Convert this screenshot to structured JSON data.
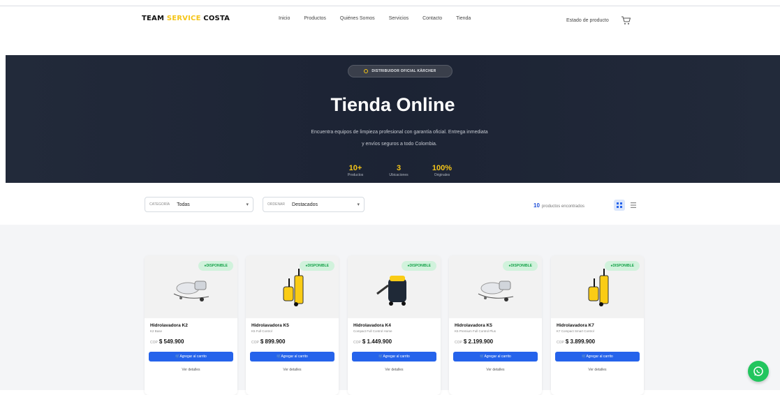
{
  "brand": {
    "part1": "TEAM",
    "part2": "SERVICE",
    "part3": "COSTA"
  },
  "nav": [
    "Inicio",
    "Productos",
    "Quiénes Somos",
    "Servicios",
    "Contacto",
    "Tienda"
  ],
  "header": {
    "status_link": "Estado de producto",
    "cart_icon": "cart-icon"
  },
  "hero": {
    "badge": "DISTRIBUIDOR OFICIAL KÄRCHER",
    "title": "Tienda Online",
    "subtitle_line1": "Encuentra equipos de limpieza profesional con garantía oficial. Entrega inmediata",
    "subtitle_line2": "y envíos seguros a todo Colombia.",
    "stats": [
      {
        "value": "10+",
        "label": "Productos"
      },
      {
        "value": "3",
        "label": "Ubicaciones"
      },
      {
        "value": "100%",
        "label": "Originales"
      }
    ]
  },
  "filters": {
    "category_label": "Categoría",
    "category_value": "Todas",
    "order_label": "Ordenar",
    "order_value": "Destacados",
    "found_count": "10",
    "found_text": "productos encontrados"
  },
  "products": [
    {
      "badge": "DISPONIBLE",
      "name": "Hidrolavadora K2",
      "sku": "K2 Base",
      "currency": "COP",
      "price": "$ 549.900",
      "add_label": "Agregar al carrito",
      "details_label": "Ver detalles"
    },
    {
      "badge": "DISPONIBLE",
      "name": "Hidrolavadora K5",
      "sku": "K5 Full Control",
      "currency": "COP",
      "price": "$ 899.900",
      "add_label": "Agregar al carrito",
      "details_label": "Ver detalles"
    },
    {
      "badge": "DISPONIBLE",
      "name": "Hidrolavadora K4",
      "sku": "Compact Full Control Home",
      "currency": "COP",
      "price": "$ 1.449.900",
      "add_label": "Agregar al carrito",
      "details_label": "Ver detalles"
    },
    {
      "badge": "DISPONIBLE",
      "name": "Hidrolavadora K5",
      "sku": "K5 Premium Full Control Plus",
      "currency": "COP",
      "price": "$ 2.199.900",
      "add_label": "Agregar al carrito",
      "details_label": "Ver detalles"
    },
    {
      "badge": "DISPONIBLE",
      "name": "Hidrolavadora K7",
      "sku": "K7 Compact Smart Control",
      "currency": "COP",
      "price": "$ 3.899.900",
      "add_label": "Agregar al carrito",
      "details_label": "Ver detalles"
    }
  ],
  "colors": {
    "accent": "#2563eb",
    "brand_yellow": "#f5c518",
    "hero_bg": "#1f2636",
    "available": "#16a34a",
    "whatsapp": "#22c55e"
  }
}
